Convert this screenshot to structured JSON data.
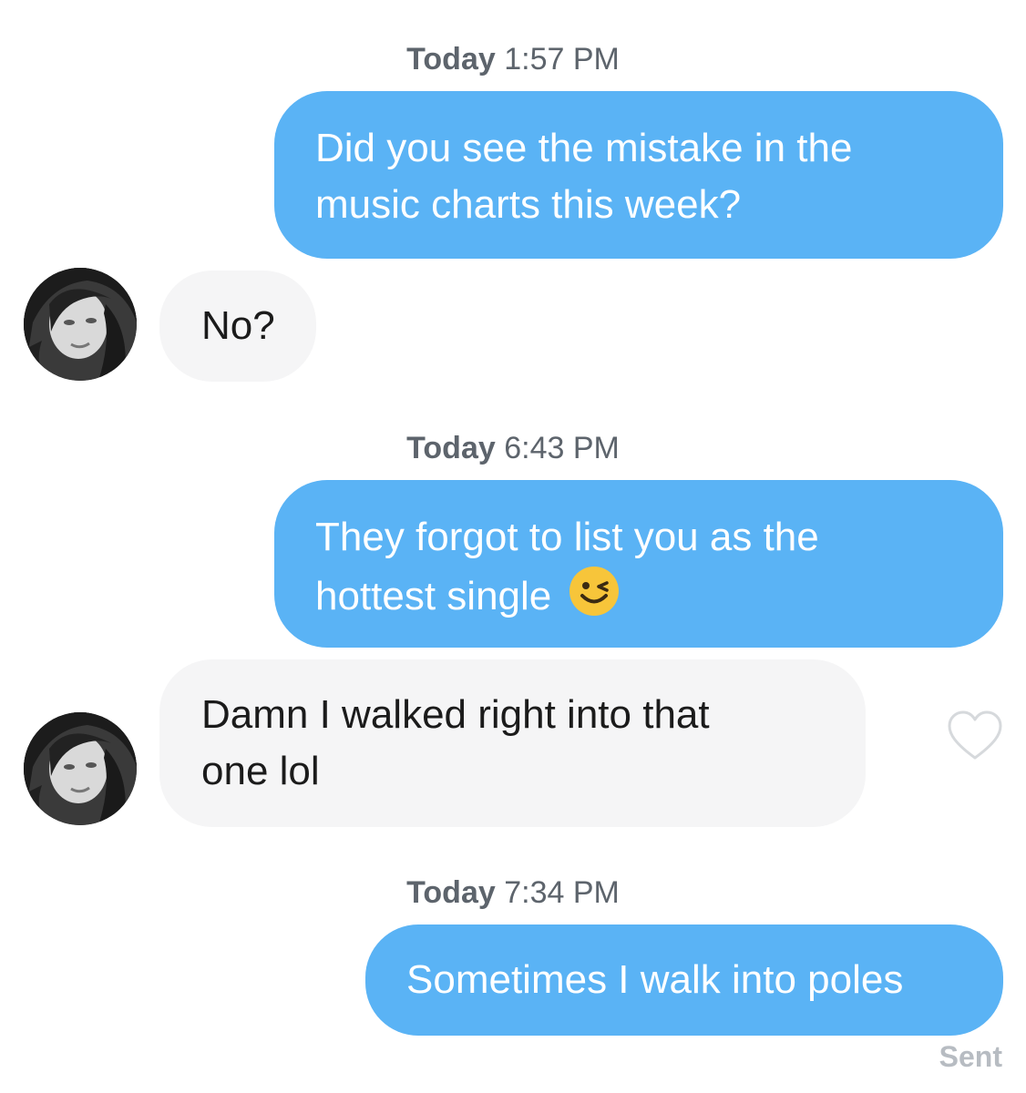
{
  "conversation": {
    "groups": [
      {
        "timestamp": {
          "day": "Today",
          "time": "1:57 PM"
        }
      },
      {
        "timestamp": {
          "day": "Today",
          "time": "6:43 PM"
        }
      },
      {
        "timestamp": {
          "day": "Today",
          "time": "7:34 PM"
        }
      }
    ],
    "messages": [
      {
        "sender": "me",
        "lines": [
          "Did you see the mistake in the",
          "music charts this week?"
        ]
      },
      {
        "sender": "match",
        "lines": [
          "No?"
        ]
      },
      {
        "sender": "me",
        "lines": [
          "They forgot to list you as the",
          "hottest single"
        ],
        "emoji": "winking-face"
      },
      {
        "sender": "match",
        "lines": [
          "Damn I walked right into that",
          "one lol"
        ],
        "reaction": "heart-outline-icon"
      },
      {
        "sender": "me",
        "lines": [
          "Sometimes I walk into poles"
        ]
      }
    ],
    "status": "Sent"
  },
  "colors": {
    "outgoing_bubble": "#5ab3f5",
    "incoming_bubble": "#f5f5f6",
    "timestamp_text": "#5d646c",
    "status_text": "#b7bcc2"
  }
}
